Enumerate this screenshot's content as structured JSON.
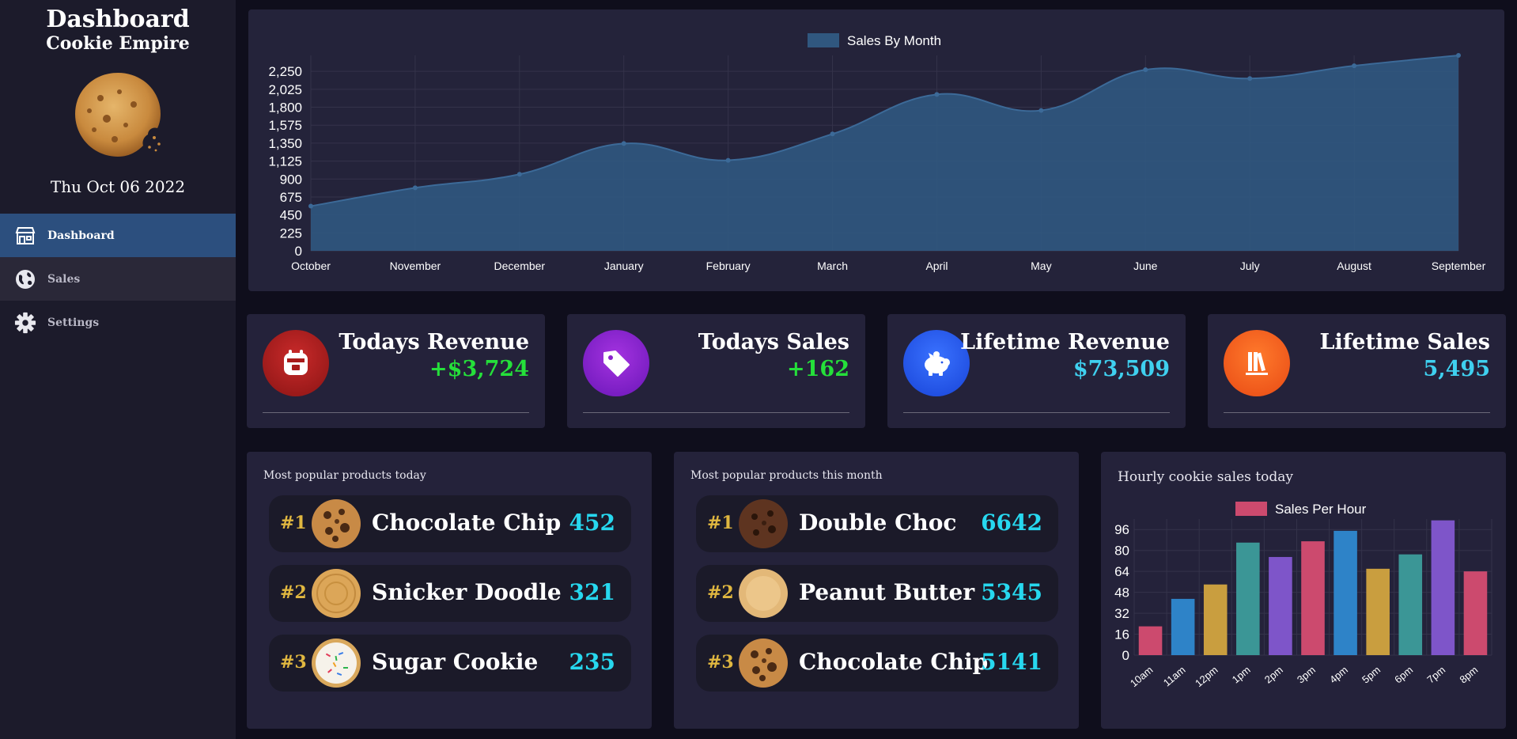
{
  "sidebar": {
    "title": "Dashboard",
    "subtitle": "Cookie Empire",
    "date": "Thu Oct 06 2022",
    "nav": [
      {
        "label": "Dashboard",
        "icon": "store-icon"
      },
      {
        "label": "Sales",
        "icon": "globe-icon"
      },
      {
        "label": "Settings",
        "icon": "gear-icon"
      }
    ]
  },
  "stats": [
    {
      "label": "Todays Revenue",
      "value": "+$3,724",
      "icon": "calendar-icon",
      "value_color": "#25e03a"
    },
    {
      "label": "Todays Sales",
      "value": "+162",
      "icon": "tag-icon",
      "value_color": "#25e03a"
    },
    {
      "label": "Lifetime Revenue",
      "value": "$73,509",
      "icon": "piggy-bank-icon",
      "value_color": "#3fd0ef"
    },
    {
      "label": "Lifetime Sales",
      "value": "5,495",
      "icon": "books-icon",
      "value_color": "#3fd0ef"
    }
  ],
  "popular_today": {
    "title": "Most popular products today",
    "items": [
      {
        "rank": "#1",
        "name": "Chocolate Chip",
        "count": "452"
      },
      {
        "rank": "#2",
        "name": "Snicker Doodle",
        "count": "321"
      },
      {
        "rank": "#3",
        "name": "Sugar Cookie",
        "count": "235"
      }
    ]
  },
  "popular_month": {
    "title": "Most popular products this month",
    "items": [
      {
        "rank": "#1",
        "name": "Double Choc",
        "count": "6642"
      },
      {
        "rank": "#2",
        "name": "Peanut Butter",
        "count": "5345"
      },
      {
        "rank": "#3",
        "name": "Chocolate Chip",
        "count": "5141"
      }
    ]
  },
  "hourly": {
    "title": "Hourly cookie sales today"
  },
  "chart_data": [
    {
      "type": "area",
      "legend": "Sales By Month",
      "legend_position": "top-center",
      "categories": [
        "October",
        "November",
        "December",
        "January",
        "February",
        "March",
        "April",
        "May",
        "June",
        "July",
        "August",
        "September"
      ],
      "values": [
        560,
        790,
        960,
        1345,
        1135,
        1465,
        1960,
        1760,
        2270,
        2160,
        2320,
        2450
      ],
      "yticks": [
        0,
        225,
        450,
        675,
        900,
        1125,
        1350,
        1575,
        1800,
        2025,
        2250
      ],
      "yticklabels": [
        "0",
        "225",
        "450",
        "675",
        "900",
        "1,125",
        "1,350",
        "1,575",
        "1,800",
        "2,025",
        "2,250"
      ],
      "ylim": [
        0,
        2450
      ],
      "grid": true,
      "color": "#30577f"
    },
    {
      "type": "bar",
      "legend": "Sales Per Hour",
      "legend_position": "top-center",
      "categories": [
        "10am",
        "11am",
        "12pm",
        "1pm",
        "2pm",
        "3pm",
        "4pm",
        "5pm",
        "6pm",
        "7pm",
        "8pm"
      ],
      "values": [
        22,
        43,
        54,
        86,
        75,
        87,
        95,
        66,
        77,
        103,
        64
      ],
      "colors": [
        "#cc4a6e",
        "#2e83c8",
        "#c99e3f",
        "#3b9696",
        "#7e55c9",
        "#cc4a6e",
        "#2e83c8",
        "#c99e3f",
        "#3b9696",
        "#7e55c9",
        "#cc4a6e"
      ],
      "yticks": [
        0,
        16,
        32,
        48,
        64,
        80,
        96
      ],
      "ylim": [
        0,
        104
      ],
      "grid": true,
      "legend_color": "#cc4a6e"
    }
  ]
}
